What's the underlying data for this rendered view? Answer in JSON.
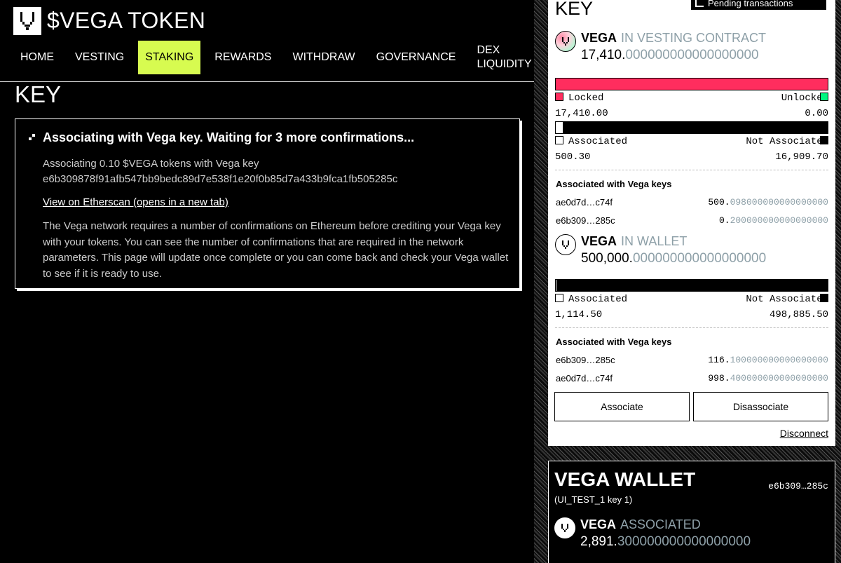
{
  "header": {
    "app_title": "$VEGA TOKEN",
    "nav": [
      {
        "label": "HOME",
        "active": false
      },
      {
        "label": "VESTING",
        "active": false
      },
      {
        "label": "STAKING",
        "active": true
      },
      {
        "label": "REWARDS",
        "active": false
      },
      {
        "label": "WITHDRAW",
        "active": false
      },
      {
        "label": "GOVERNANCE",
        "active": false
      },
      {
        "label_line1": "DEX",
        "label_line2": "LIQUIDITY",
        "active": false
      }
    ]
  },
  "main": {
    "page_title": "KEY",
    "panel": {
      "heading": "Associating with Vega key. Waiting for 3 more confirmations...",
      "line1": "Associating 0.10 $VEGA tokens with Vega key",
      "vega_key": "e6b309878f91afb547bb9bedc89d7e538f1e20f0b85d7a433b9fca1fb505285c",
      "link": "View on Etherscan (opens in a new tab)",
      "body": "The Vega network requires a number of confirmations on Ethereum before crediting your Vega key with your tokens. You can see the number of confirmations that are required in the network parameters. This page will update once complete or you can come back and check your Vega wallet to see if it is ready to use."
    }
  },
  "sidebar": {
    "key_card": {
      "title": "KEY",
      "pending_label": "Pending transactions",
      "vesting": {
        "token": "VEGA",
        "sub": "IN VESTING CONTRACT",
        "amount_int": "17,410.",
        "amount_dec": "000000000000000000",
        "bar_locked_fraction": 1.0,
        "locked_label": "Locked",
        "unlocked_label": "Unlocked",
        "locked_value": "17,410.00",
        "unlocked_value": "0.00",
        "assoc_bar_fraction": 0.029,
        "associated_label": "Associated",
        "not_associated_label": "Not Associated",
        "associated_value": "500.30",
        "not_associated_value": "16,909.70",
        "assoc_heading": "Associated with Vega keys",
        "keys": [
          {
            "key": "ae0d7d…c74f",
            "int": "500.",
            "dec": "098000000000000000"
          },
          {
            "key": "e6b309…285c",
            "int": "0.",
            "dec": "200000000000000000"
          }
        ]
      },
      "wallet": {
        "token": "VEGA",
        "sub": "IN WALLET",
        "amount_int": "500,000.",
        "amount_dec": "000000000000000000",
        "assoc_bar_fraction": 0.002,
        "associated_label": "Associated",
        "not_associated_label": "Not Associated",
        "associated_value": "1,114.50",
        "not_associated_value": "498,885.50",
        "assoc_heading": "Associated with Vega keys",
        "keys": [
          {
            "key": "e6b309…285c",
            "int": "116.",
            "dec": "100000000000000000"
          },
          {
            "key": "ae0d7d…c74f",
            "int": "998.",
            "dec": "400000000000000000"
          }
        ]
      },
      "associate_label": "Associate",
      "disassociate_label": "Disassociate",
      "disconnect_label": "Disconnect"
    },
    "vega_wallet": {
      "title": "VEGA WALLET",
      "key_short": "e6b309…285c",
      "subtitle": "(UI_TEST_1 key 1)",
      "token": "VEGA",
      "sub": "ASSOCIATED",
      "amount_int": "2,891.",
      "amount_dec": "300000000000000000"
    }
  },
  "colors": {
    "accent": "#d7fb50",
    "locked": "#ff2d5e",
    "unlocked": "#00f780",
    "muted": "#8ea0a8"
  }
}
